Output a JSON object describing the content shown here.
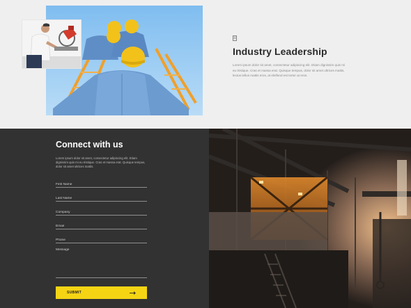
{
  "about": {
    "title": "Industry Leadership",
    "body": "Lorem ipsum dolor sit amet, consectetur adipiscing elit. Etiam dignissim quis mi eu tristique. Cras et massa erat. Quisque tempus, dolor sit amet ultrices mattis, lectus tellus mattis eros, at eleifend est tortor at eros.",
    "icon": "document-icon"
  },
  "contact": {
    "title": "Connect with us",
    "intro": "Lorem ipsum dolor sit amet, consectetur adipiscing elit. Etiam dignissim quis mi eu tristique. Cras et massa erat. Quisque tempus, dolor sit amet ultrices mattis.",
    "fields": {
      "first_name": "First Name",
      "last_name": "Last Name",
      "company": "Company",
      "email": "Email",
      "phone": "Phone",
      "message": "Message"
    },
    "submit_label": "SUBMIT",
    "submit_icon": "arrow-right-icon"
  },
  "colors": {
    "accent": "#f5d414",
    "dark_panel": "#323232",
    "light_bg": "#efefef"
  }
}
